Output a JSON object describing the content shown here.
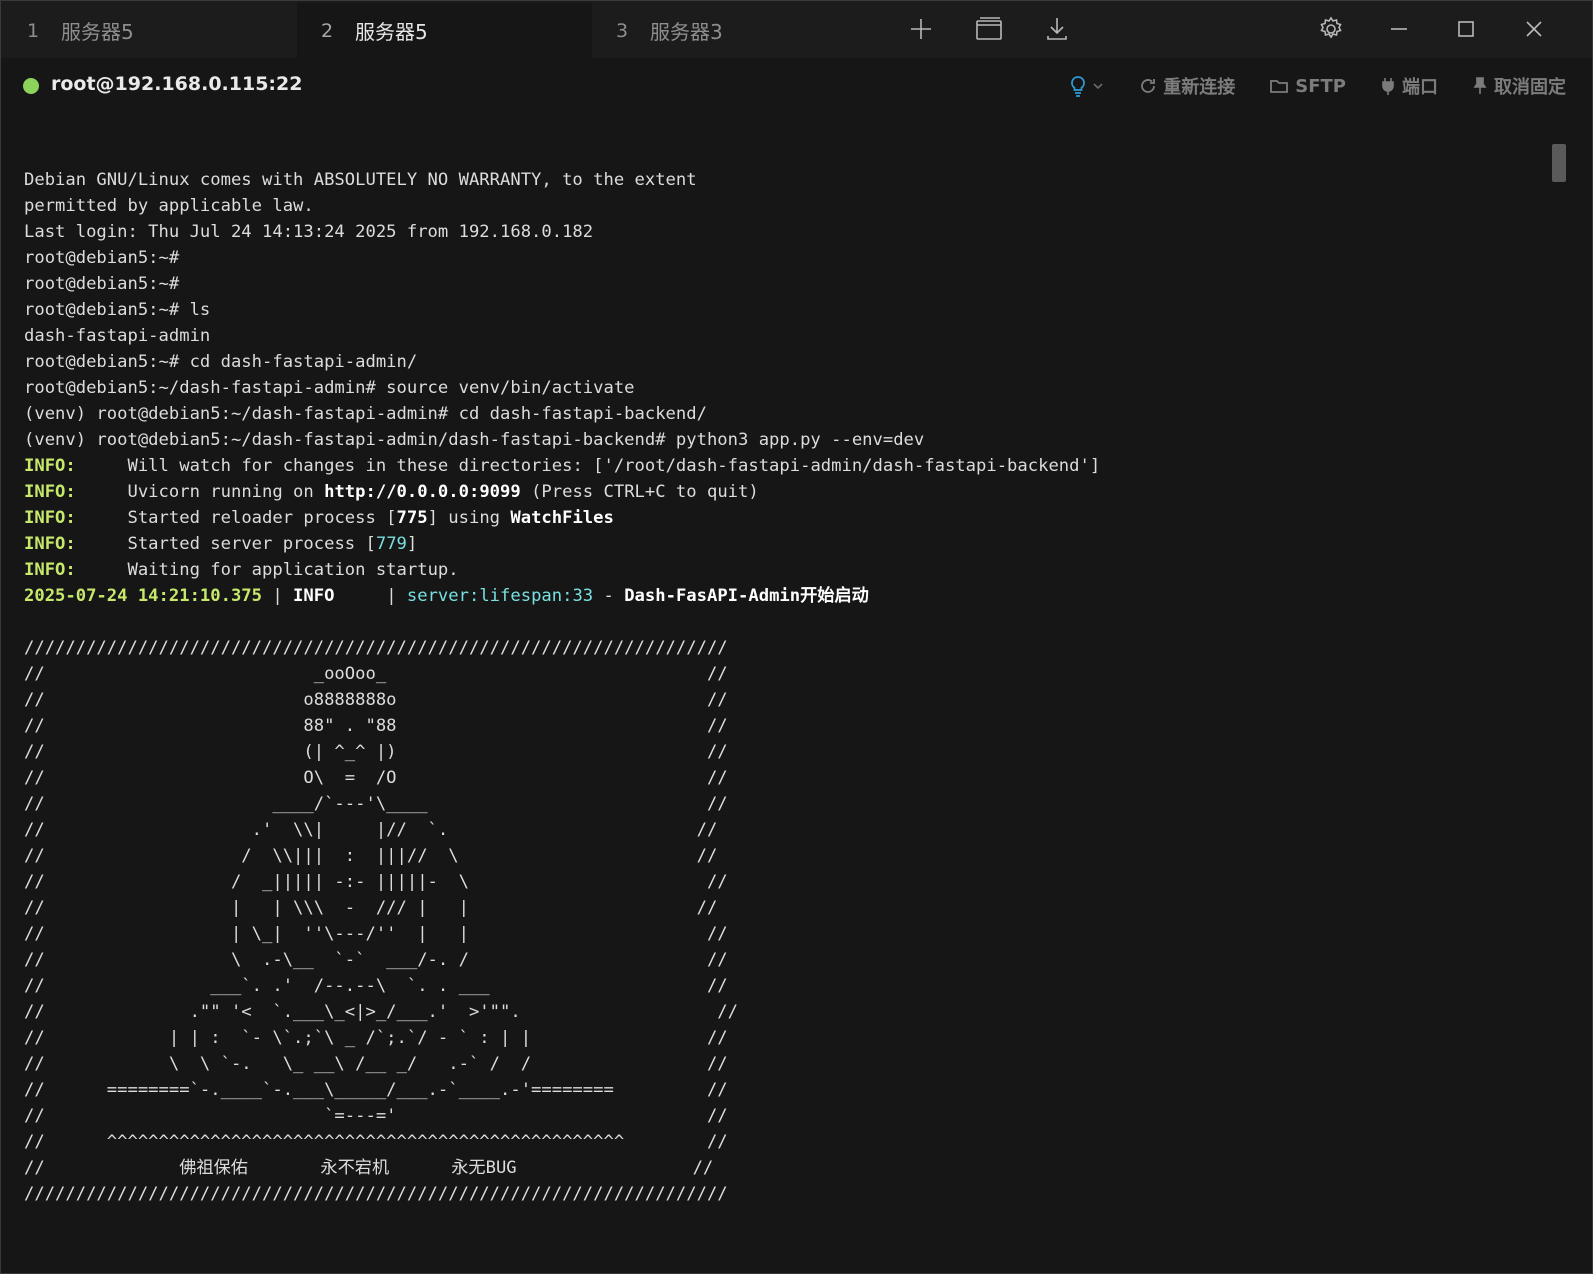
{
  "tabs": [
    {
      "num": "1",
      "label": "服务器5",
      "active": false
    },
    {
      "num": "2",
      "label": "服务器5",
      "active": true
    },
    {
      "num": "3",
      "label": "服务器3",
      "active": false
    }
  ],
  "toolbar_icons": [
    "plus-icon",
    "window-layout-icon",
    "download-icon",
    "gear-icon",
    "minimize-icon",
    "maximize-icon",
    "close-icon"
  ],
  "session": {
    "host": "root@192.168.0.115:22",
    "status_color": "#8bd35a",
    "actions": {
      "reconnect": "重新连接",
      "sftp": "SFTP",
      "port": "端口",
      "unpin": "取消固定"
    }
  },
  "terminal": {
    "lines": [
      [
        {
          "t": "Debian GNU/Linux comes with ABSOLUTELY NO WARRANTY, to the extent"
        }
      ],
      [
        {
          "t": "permitted by applicable law."
        }
      ],
      [
        {
          "t": "Last login: Thu Jul 24 14:13:24 2025 from 192.168.0.182"
        }
      ],
      [
        {
          "t": "root@debian5:~#"
        }
      ],
      [
        {
          "t": "root@debian5:~#"
        }
      ],
      [
        {
          "t": "root@debian5:~# ls"
        }
      ],
      [
        {
          "t": "dash-fastapi-admin"
        }
      ],
      [
        {
          "t": "root@debian5:~# cd dash-fastapi-admin/"
        }
      ],
      [
        {
          "t": "root@debian5:~/dash-fastapi-admin# source venv/bin/activate"
        }
      ],
      [
        {
          "t": "(venv) root@debian5:~/dash-fastapi-admin# cd dash-fastapi-backend/"
        }
      ],
      [
        {
          "t": "(venv) root@debian5:~/dash-fastapi-admin/dash-fastapi-backend# python3 app.py --env=dev"
        }
      ],
      [
        {
          "t": "INFO:",
          "c": "info"
        },
        {
          "t": "     Will watch for changes in these directories: ['/root/dash-fastapi-admin/dash-fastapi-backend']"
        }
      ],
      [
        {
          "t": "INFO:",
          "c": "info"
        },
        {
          "t": "     Uvicorn running on "
        },
        {
          "t": "http://0.0.0.0:9099",
          "c": "bold"
        },
        {
          "t": " (Press CTRL+C to quit)"
        }
      ],
      [
        {
          "t": "INFO:",
          "c": "info"
        },
        {
          "t": "     Started reloader process ["
        },
        {
          "t": "775",
          "c": "cyan bold"
        },
        {
          "t": "] using "
        },
        {
          "t": "WatchFiles",
          "c": "cyan bold"
        }
      ],
      [
        {
          "t": "INFO:",
          "c": "info"
        },
        {
          "t": "     Started server process ["
        },
        {
          "t": "779",
          "c": "cyan"
        },
        {
          "t": "]"
        }
      ],
      [
        {
          "t": "INFO:",
          "c": "info"
        },
        {
          "t": "     Waiting for application startup."
        }
      ],
      [
        {
          "t": "2025-07-24 14:21:10.375",
          "c": "ts"
        },
        {
          "t": " | "
        },
        {
          "t": "INFO",
          "c": "bold"
        },
        {
          "t": "     | "
        },
        {
          "t": "server:lifespan:33",
          "c": "cyan"
        },
        {
          "t": " - "
        },
        {
          "t": "Dash-FasAPI-Admin开始启动",
          "c": "bold"
        }
      ],
      [
        {
          "t": ""
        }
      ],
      [
        {
          "t": "////////////////////////////////////////////////////////////////////"
        }
      ],
      [
        {
          "t": "//                          _ooOoo_                               //"
        }
      ],
      [
        {
          "t": "//                         o8888888o                              //"
        }
      ],
      [
        {
          "t": "//                         88\" . \"88                              //"
        }
      ],
      [
        {
          "t": "//                         (| ^_^ |)                              //"
        }
      ],
      [
        {
          "t": "//                         O\\  =  /O                              //"
        }
      ],
      [
        {
          "t": "//                      ____/`---'\\____                           //"
        }
      ],
      [
        {
          "t": "//                    .'  \\\\|     |//  `.                        //"
        }
      ],
      [
        {
          "t": "//                   /  \\\\|||  :  |||//  \\                       //"
        }
      ],
      [
        {
          "t": "//                  /  _||||| -:- |||||-  \\                       //"
        }
      ],
      [
        {
          "t": "//                  |   | \\\\\\  -  /// |   |                      //"
        }
      ],
      [
        {
          "t": "//                  | \\_|  ''\\---/''  |   |                       //"
        }
      ],
      [
        {
          "t": "//                  \\  .-\\__  `-`  ___/-. /                       //"
        }
      ],
      [
        {
          "t": "//                ___`. .'  /--.--\\  `. . ___                     //"
        }
      ],
      [
        {
          "t": "//              .\"\" '<  `.___\\_<|>_/___.'  >'\"\".                   //"
        }
      ],
      [
        {
          "t": "//            | | :  `- \\`.;`\\ _ /`;.`/ - ` : | |                 //"
        }
      ],
      [
        {
          "t": "//            \\  \\ `-.   \\_ __\\ /__ _/   .-` /  /                 //"
        }
      ],
      [
        {
          "t": "//      ========`-.____`-.___\\_____/___.-`____.-'========         //"
        }
      ],
      [
        {
          "t": "//                           `=---='                              //"
        }
      ],
      [
        {
          "t": "//      ^^^^^^^^^^^^^^^^^^^^^^^^^^^^^^^^^^^^^^^^^^^^^^^^^^        //"
        }
      ],
      [
        {
          "t": "//             佛祖保佑       永不宕机      永无BUG                 //"
        }
      ],
      [
        {
          "t": "////////////////////////////////////////////////////////////////////"
        }
      ]
    ]
  }
}
